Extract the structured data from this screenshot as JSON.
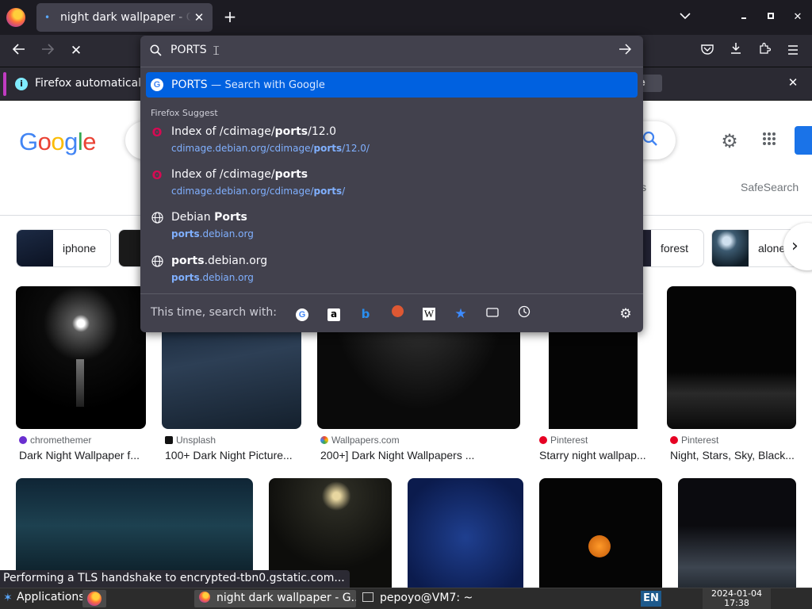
{
  "browser": {
    "tab": {
      "title": "night dark wallpaper - Google Search"
    },
    "notification": {
      "text": "Firefox automatically",
      "button_label": "e"
    }
  },
  "urlbar": {
    "input_value": "PORTS",
    "active_suggestion": {
      "text": "PORTS",
      "separator": "—",
      "action": "Search with Google"
    },
    "heading": "Firefox Suggest",
    "suggestions": [
      {
        "title_pre": "Index of /cdimage/",
        "title_bold": "ports",
        "title_post": "/12.0",
        "url_pre": "cdimage.debian.org/cdimage/",
        "url_bold": "ports",
        "url_post": "/12.0/",
        "icon": "debian-icon"
      },
      {
        "title_pre": "Index of /cdimage/",
        "title_bold": "ports",
        "title_post": "",
        "url_pre": "cdimage.debian.org/cdimage/",
        "url_bold": "ports",
        "url_post": "/",
        "icon": "debian-icon"
      },
      {
        "title_pre": "Debian ",
        "title_bold": "Ports",
        "title_post": "",
        "url_pre": "",
        "url_bold": "ports",
        "url_post": ".debian.org",
        "icon": "globe-icon"
      },
      {
        "title_pre": "",
        "title_bold": "ports",
        "title_post": ".debian.org",
        "url_pre": "",
        "url_bold": "ports",
        "url_post": ".debian.org",
        "icon": "globe-icon"
      }
    ],
    "oneoff_label": "This time, search with:"
  },
  "google": {
    "logo_letters": [
      "G",
      "o",
      "o",
      "g",
      "l",
      "e"
    ],
    "tools_partial": "ls",
    "safesearch": "SafeSearch",
    "chips": [
      "iphone",
      "forest",
      "alone"
    ],
    "results_row1": [
      {
        "source": "chromethemer",
        "caption": "Dark Night Wallpaper f...",
        "dot": "#6a2fd0"
      },
      {
        "source": "Unsplash",
        "caption": "100+ Dark Night Picture...",
        "dot": "#111111"
      },
      {
        "source": "Wallpapers.com",
        "caption": "200+] Dark Night Wallpapers ...",
        "dot": "#34a853"
      },
      {
        "source": "Pinterest",
        "caption": "Starry night wallpap...",
        "dot": "#e60023"
      },
      {
        "source": "Pinterest",
        "caption": "Night, Stars, Sky, Black...",
        "dot": "#e60023"
      }
    ]
  },
  "status": {
    "text": "Performing a TLS handshake to encrypted-tbn0.gstatic.com..."
  },
  "taskbar": {
    "apps_label": "Applications",
    "window1": "night dark wallpaper - G...",
    "window2": "pepoyo@VM7: ~",
    "lang": "EN",
    "date": "2024-01-04",
    "time": "17:38"
  }
}
